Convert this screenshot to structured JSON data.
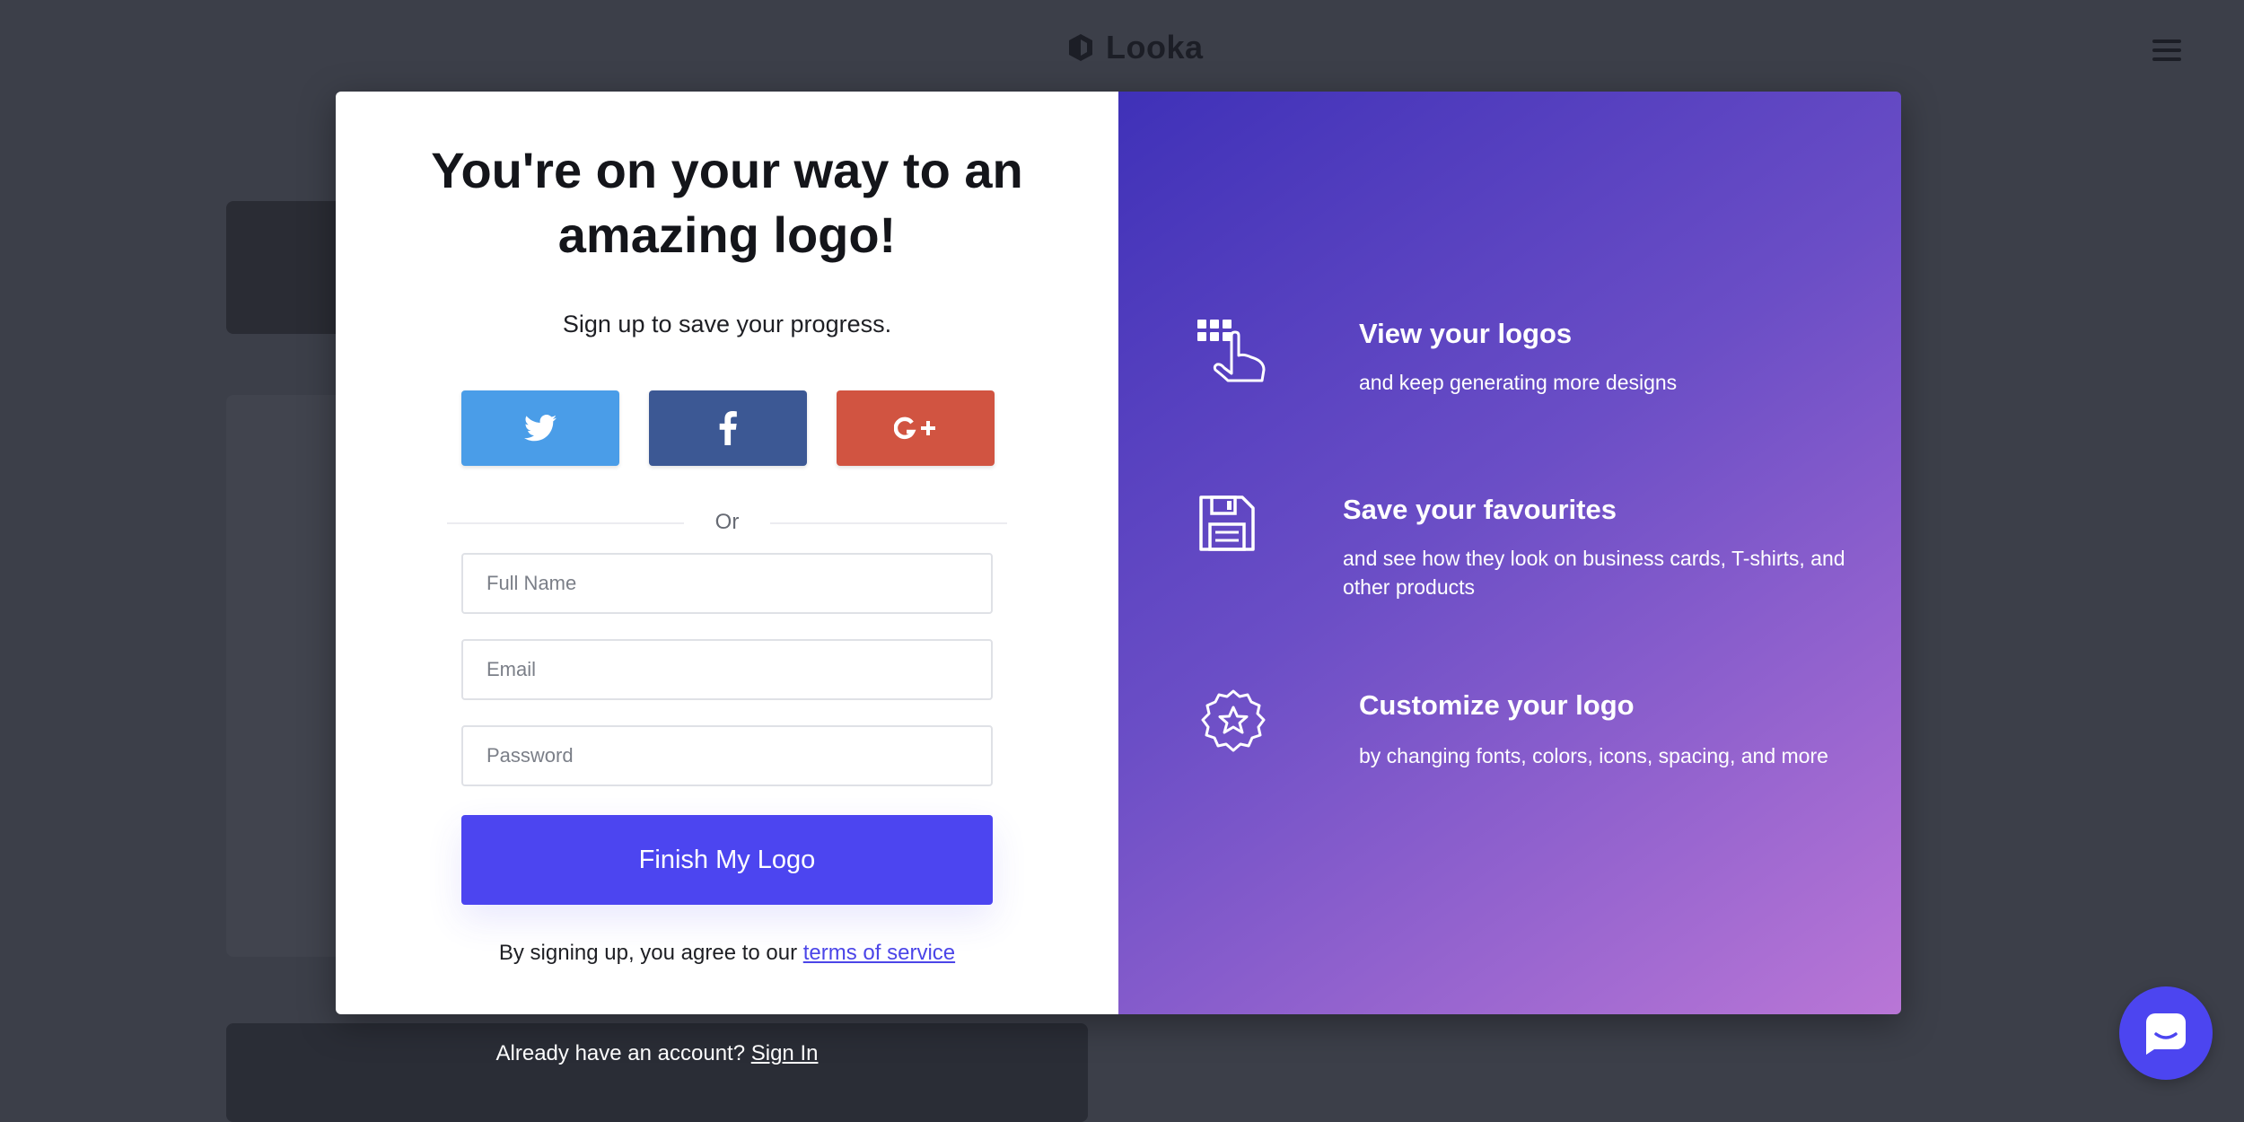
{
  "brand": {
    "name": "Looka"
  },
  "modal": {
    "headline": "You're on your way to an amazing logo!",
    "subline": "Sign up to save your progress.",
    "social": [
      {
        "name": "twitter",
        "icon": "twitter-icon",
        "color": "#4a9de8"
      },
      {
        "name": "facebook",
        "icon": "facebook-icon",
        "color": "#3c5894"
      },
      {
        "name": "google-plus",
        "icon": "google-plus-icon",
        "color": "#d15441"
      }
    ],
    "divider_text": "Or",
    "form": {
      "full_name_placeholder": "Full Name",
      "email_placeholder": "Email",
      "password_placeholder": "Password",
      "submit_label": "Finish My Logo"
    },
    "terms_text": "By signing up, you agree to our",
    "terms_link": "terms of service",
    "features": [
      {
        "icon": "grid-pointer-icon",
        "title": "View your logos",
        "desc": "and keep generating more designs"
      },
      {
        "icon": "floppy-disk-icon",
        "title": "Save your favourites",
        "desc": "and see how they look on business cards, T-shirts, and other products"
      },
      {
        "icon": "badge-star-icon",
        "title": "Customize your logo",
        "desc": "by changing fonts, colors, icons, spacing, and more"
      }
    ]
  },
  "background": {
    "account_text": "Already have an account?",
    "sign_in_link": "Sign In"
  },
  "colors": {
    "accent": "#4c45f0",
    "overlay_bg": "#3c3f49",
    "gradient_start": "#3f31b8",
    "gradient_end": "#b976d6"
  },
  "chat": {
    "icon": "chat-bubble-icon"
  }
}
